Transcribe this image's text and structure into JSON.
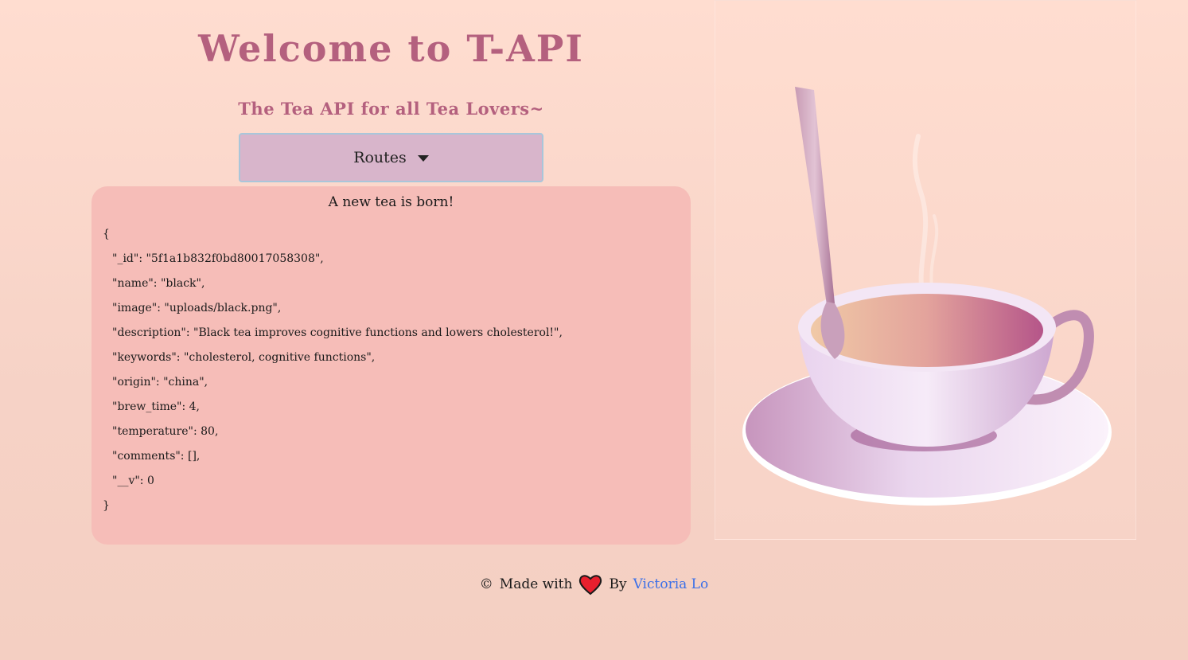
{
  "header": {
    "title": "Welcome to T-API",
    "subtitle": "The Tea API for all Tea Lovers~"
  },
  "routes_dropdown": {
    "label": "Routes"
  },
  "response_panel": {
    "title": "A new tea is born!",
    "json_lines": [
      {
        "text": "{",
        "indent": false
      },
      {
        "text": "\"_id\": \"5f1a1b832f0bd80017058308\",",
        "indent": true
      },
      {
        "text": "\"name\": \"black\",",
        "indent": true
      },
      {
        "text": "\"image\": \"uploads/black.png\",",
        "indent": true
      },
      {
        "text": "\"description\": \"Black tea improves cognitive functions and lowers cholesterol!\",",
        "indent": true
      },
      {
        "text": "\"keywords\": \"cholesterol, cognitive functions\",",
        "indent": true
      },
      {
        "text": "\"origin\": \"china\",",
        "indent": true
      },
      {
        "text": "\"brew_time\": 4,",
        "indent": true
      },
      {
        "text": "\"temperature\": 80,",
        "indent": true
      },
      {
        "text": "\"comments\": [],",
        "indent": true
      },
      {
        "text": "\"__v\": 0",
        "indent": true
      },
      {
        "text": "}",
        "indent": false
      }
    ]
  },
  "hero": {
    "icon": "teacup-illustration"
  },
  "footer": {
    "copyright_symbol": "©",
    "made_with": "Made with",
    "heart_icon": "heart-icon",
    "by": "By",
    "author": "Victoria Lo"
  },
  "colors": {
    "accent": "#b4607e",
    "button_bg": "#d8b5cb",
    "panel_bg": "#f6bdb8",
    "link": "#3a6fe8",
    "heart": "#e8202e"
  }
}
